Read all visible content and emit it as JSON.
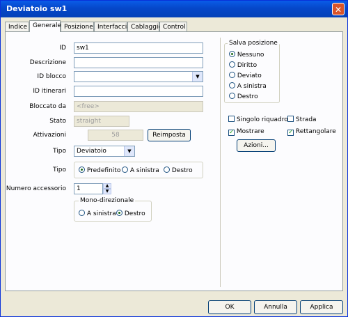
{
  "window": {
    "title": "Deviatoio sw1",
    "close_glyph": "✕"
  },
  "tabs": [
    {
      "label": "Indice"
    },
    {
      "label": "Generale"
    },
    {
      "label": "Posizione"
    },
    {
      "label": "Interfaccia"
    },
    {
      "label": "Cablaggio"
    },
    {
      "label": "Control"
    }
  ],
  "form": {
    "id_label": "ID",
    "id_value": "sw1",
    "descrizione_label": "Descrizione",
    "descrizione_value": "",
    "id_blocco_label": "ID blocco",
    "id_blocco_value": "",
    "id_itinerari_label": "ID itinerari",
    "id_itinerari_value": "",
    "bloccato_label": "Bloccato da",
    "bloccato_value": "<free>",
    "stato_label": "Stato",
    "stato_value": "straight",
    "attivazioni_label": "Attivazioni",
    "attivazioni_value": "58",
    "reimposta_label": "Reimposta",
    "tipo_label": "Tipo",
    "tipo_value": "Deviatoio",
    "tipo2_label": "Tipo",
    "tipo2_options": [
      "Predefinito",
      "A sinistra",
      "Destro"
    ],
    "tipo2_selected": "Predefinito",
    "numero_label": "Numero accessorio",
    "numero_value": "1",
    "mono_title": "Mono-direzionale",
    "mono_options": [
      "A sinistra",
      "Destro"
    ],
    "mono_selected": "Destro"
  },
  "salva": {
    "title": "Salva posizione",
    "options": [
      "Nessuno",
      "Diritto",
      "Deviato",
      "A sinistra",
      "Destro"
    ],
    "selected": "Nessuno"
  },
  "checks": {
    "singolo": "Singolo riquadro",
    "singolo_checked": false,
    "strada": "Strada",
    "strada_checked": false,
    "mostrare": "Mostrare",
    "mostrare_checked": true,
    "rettangolare": "Rettangolare",
    "rettangolare_checked": true
  },
  "azioni_label": "Azioni...",
  "footer": {
    "ok": "OK",
    "annulla": "Annulla",
    "applica": "Applica"
  }
}
